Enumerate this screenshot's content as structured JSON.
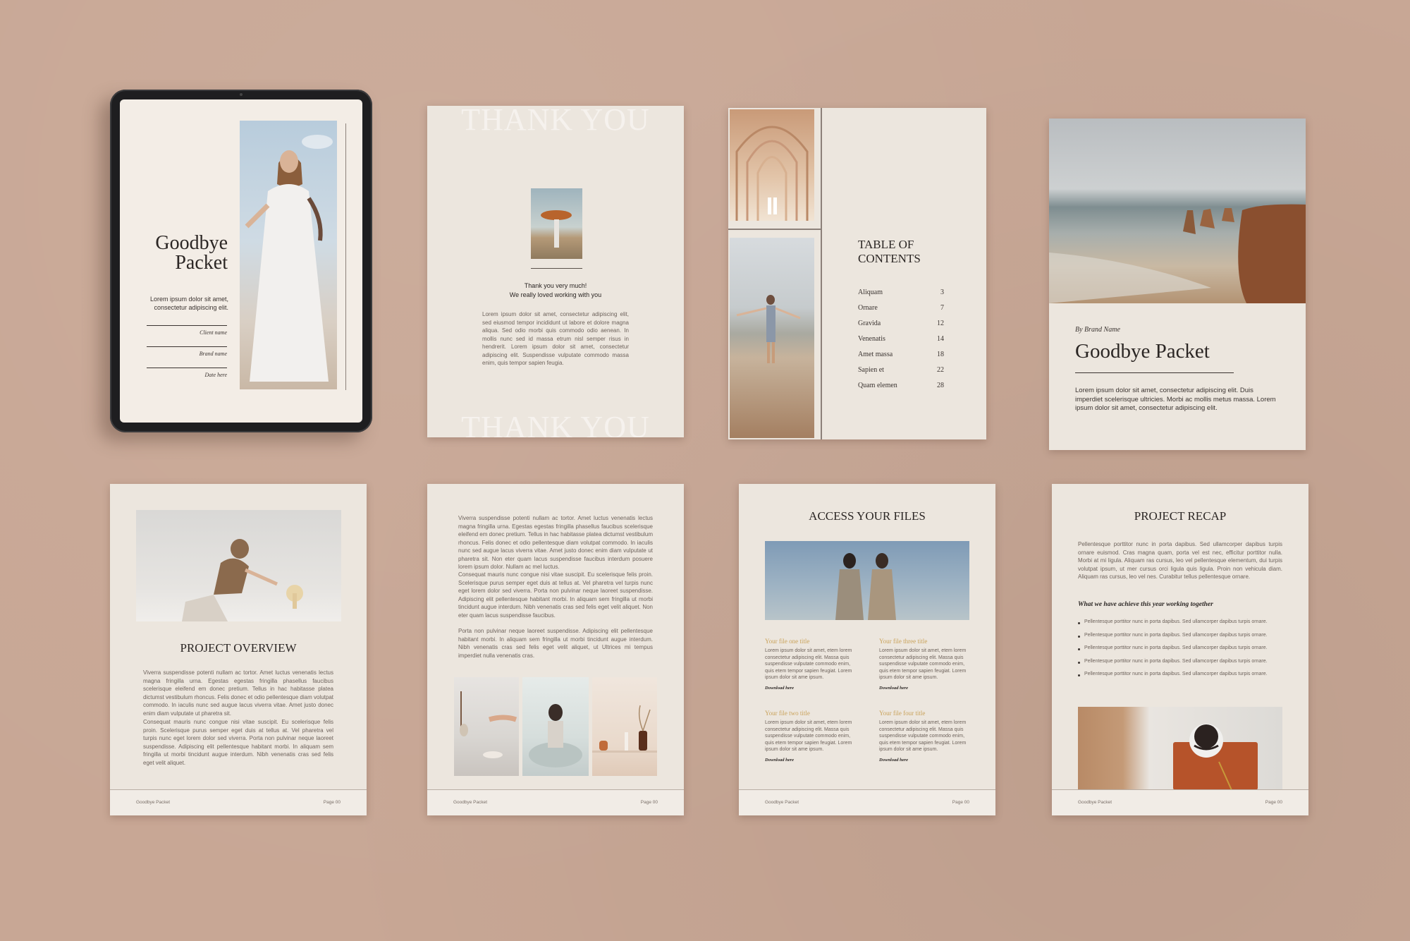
{
  "tablet": {
    "title_line1": "Goodbye",
    "title_line2": "Packet",
    "intro_line1": "Lorem ipsum dolor sit amet,",
    "intro_line2": "consectetur adipiscing elit.",
    "field1": "Client name",
    "field2": "Brand name",
    "field3": "Date here"
  },
  "thank_you": {
    "watermark_top": "THANK YOU",
    "watermark_bottom": "THANK YOU",
    "line1": "Thank you very much!",
    "line2": "We really loved working with you",
    "body": "Lorem ipsum dolor sit amet, consectetur adipiscing elit, sed eiusmod tempor incididunt ut labore et dolore magna aliqua. Sed odio morbi quis commodo odio aenean. In mollis nunc sed id massa etrum nisl semper risus in hendrerit. Lorem ipsum dolor sit amet, consectetur adipiscing elit. Suspendisse vulputate commodo massa enim, quis tempor sapien feugia."
  },
  "toc": {
    "title_line1": "TABLE OF",
    "title_line2": "CONTENTS",
    "items": [
      {
        "label": "Aliquam",
        "page": "3"
      },
      {
        "label": "Ornare",
        "page": "7"
      },
      {
        "label": "Gravida",
        "page": "12"
      },
      {
        "label": "Venenatis",
        "page": "14"
      },
      {
        "label": "Amet massa",
        "page": "18"
      },
      {
        "label": "Sapien et",
        "page": "22"
      },
      {
        "label": "Quam elemen",
        "page": "28"
      }
    ]
  },
  "cover": {
    "byline": "By Brand Name",
    "title": "Goodbye Packet",
    "body": "Lorem ipsum dolor sit amet, consectetur adipiscing elit. Duis imperdiet scelerisque ultricies. Morbi ac mollis metus massa. Lorem ipsum dolor sit amet, consectetur adipiscing elit."
  },
  "overview": {
    "title": "PROJECT OVERVIEW",
    "para1": "Viverra suspendisse potenti nullam ac tortor. Amet luctus venenatis lectus magna fringilla urna. Egestas egestas fringilla phasellus faucibus scelerisque eleifend em donec pretium. Tellus in hac habitasse platea dictumst vestibulum rhoncus. Felis donec et odio pellentesque diam volutpat commodo. In iaculis nunc sed augue lacus viverra vitae. Amet justo donec enim diam vulputate ut pharetra sit.",
    "para2": "Consequat mauris nunc congue nisi vitae suscipit. Eu scelerisque felis proin. Scelerisque purus semper eget duis at tellus at. Vel pharetra vel turpis nunc eget lorem dolor sed viverra. Porta non pulvinar neque laoreet suspendisse. Adipiscing elit pellentesque habitant morbi. In aliquam sem fringilla ut morbi tincidunt augue interdum. Nibh venenatis cras sed felis eget velit aliquet.",
    "footer_left": "Goodbye Packet",
    "footer_right": "Page 00"
  },
  "text_page": {
    "para1": "Viverra suspendisse potenti nullam ac tortor. Amet luctus venenatis lectus magna fringilla urna. Egestas egestas fringilla phasellus faucibus scelerisque eleifend em donec pretium. Tellus in hac habitasse platea dictumst vestibulum rhoncus. Felis donec et odio pellentesque diam volutpat commodo. In iaculis nunc sed augue lacus viverra vitae. Amet justo donec enim diam vulputate ut pharetra sit. Non eter quam lacus suspendisse faucibus interdum posuere lorem ipsum dolor. Nullam ac mel luctus.",
    "para2": "Consequat mauris nunc congue nisi vitae suscipit. Eu scelerisque felis proin. Scelerisque purus semper eget duis at tellus at. Vel pharetra vel turpis nunc eget lorem dolor sed viverra. Porta non pulvinar neque laoreet suspendisse. Adipiscing elit pellentesque habitant morbi. In aliquam sem fringilla ut morbi tincidunt augue interdum. Nibh venenatis cras sed felis eget velit aliquet. Non eter quam lacus suspendisse faucibus.",
    "para3": "Porta non pulvinar neque laoreet suspendisse. Adipiscing elit pellentesque habitant morbi. In aliquam sem fringilla ut morbi tincidunt augue interdum. Nibh venenatis cras sed felis eget velit aliquet, ut Ultrices mi tempus imperdiet nulla venenatis cras.",
    "footer_left": "Goodbye Packet",
    "footer_right": "Page 00"
  },
  "files": {
    "title": "ACCESS YOUR FILES",
    "items": [
      {
        "title": "Your file one title",
        "body": "Lorem ipsum dolor sit amet, etem lorem consectetur adipiscing elit. Massa quis suspendisse vulputate commodo enim, quis etem tempor sapien feugiat. Lorem ipsum dolor sit ame ipsum.",
        "link": "Download here"
      },
      {
        "title": "Your file three title",
        "body": "Lorem ipsum dolor sit amet, etem lorem consectetur adipiscing elit. Massa quis suspendisse vulputate commodo enim, quis etem tempor sapien feugiat. Lorem ipsum dolor sit ame ipsum.",
        "link": "Download here"
      },
      {
        "title": "Your file two title",
        "body": "Lorem ipsum dolor sit amet, etem lorem consectetur adipiscing elit. Massa quis suspendisse vulputate commodo enim, quis etem tempor sapien feugiat. Lorem ipsum dolor sit ame ipsum.",
        "link": "Download here"
      },
      {
        "title": "Your file four title",
        "body": "Lorem ipsum dolor sit amet, etem lorem consectetur adipiscing elit. Massa quis suspendisse vulputate commodo enim, quis etem tempor sapien feugiat. Lorem ipsum dolor sit ame ipsum.",
        "link": "Download here"
      }
    ],
    "footer_left": "Goodbye Packet",
    "footer_right": "Page 00"
  },
  "recap": {
    "title": "PROJECT RECAP",
    "intro": "Pellentesque porttitor nunc in porta dapibus. Sed ullamcorper dapibus turpis ornare euismod. Cras magna quam, porta vel est nec, efficitur porttitor nulla. Morbi at mi ligula. Aliquam ras cursus, leo vel pellentesque elementum, dui turpis volutpat ipsum, ut mer cursus orci ligula quis ligula. Proin non vehicula diam. Aliquam ras cursus, leo vel nes. Curabitur tellus pellentesque ornare.",
    "subtitle": "What we have achieve this year working together",
    "bullets": [
      "Pellentesque porttitor nunc in porta dapibus. Sed ullamcorper dapibus turpis ornare.",
      "Pellentesque porttitor nunc in porta dapibus. Sed ullamcorper dapibus turpis ornare.",
      "Pellentesque porttitor nunc in porta dapibus. Sed ullamcorper dapibus turpis ornare.",
      "Pellentesque porttitor nunc in porta dapibus. Sed ullamcorper dapibus turpis ornare.",
      "Pellentesque porttitor nunc in porta dapibus. Sed ullamcorper dapibus turpis ornare."
    ],
    "footer_left": "Goodbye Packet",
    "footer_right": "Page 00"
  },
  "colors": {
    "background": "#c8a795",
    "page": "#ece6de",
    "accent": "#c9a25a",
    "text": "#3a3330"
  }
}
